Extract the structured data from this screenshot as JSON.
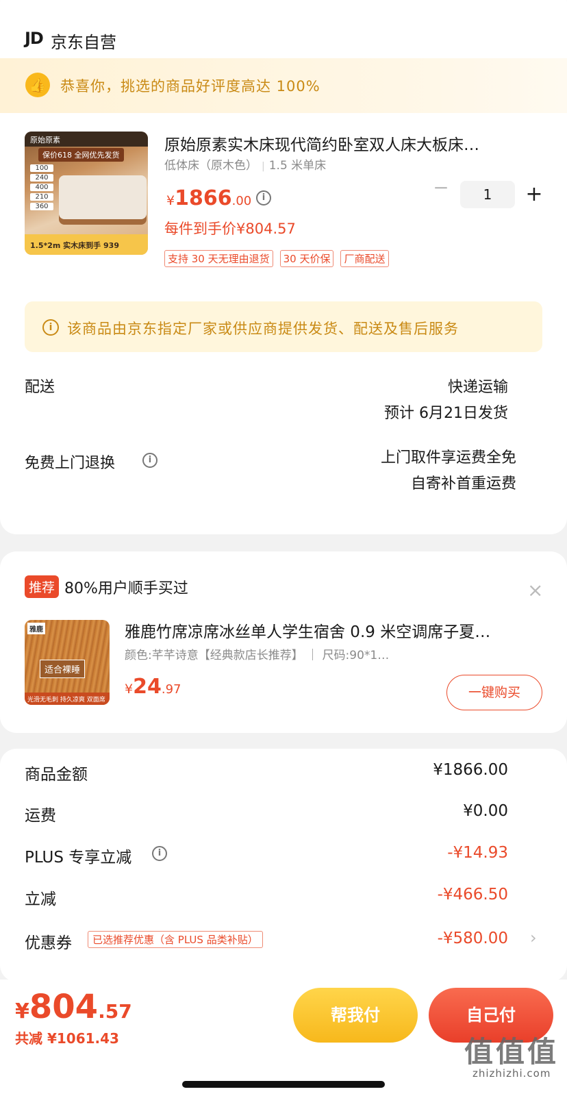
{
  "header": {
    "logo": "JD",
    "title": "京东自营"
  },
  "banner": {
    "text": "恭喜你，挑选的商品好评度高达 100%",
    "icon": "thumbs-up-icon"
  },
  "product": {
    "title": "原始原素实木床现代简约卧室双人床大板床…",
    "spec_color": "低体床（原木色）",
    "spec_size": "1.5 米单床",
    "price_currency": "¥",
    "price_int": "1866",
    "price_dec": ".00",
    "final_price": "每件到手价¥804.57",
    "tags": [
      "支持 30 天无理由退货",
      "30 天价保",
      "厂商配送"
    ],
    "quantity": "1",
    "minus": "−",
    "plus": "+",
    "image": {
      "brand": "原始原素",
      "promo": "保价618 全网优先发货",
      "sizes": [
        "100",
        "240",
        "400",
        "210",
        "360"
      ],
      "bottom": "1.5*2m 实木床到手 939"
    }
  },
  "notice": {
    "text": "该商品由京东指定厂家或供应商提供发货、配送及售后服务"
  },
  "delivery": {
    "label": "配送",
    "method": "快递运输",
    "eta": "预计 6月21日发货"
  },
  "returns": {
    "label": "免费上门退换",
    "line1": "上门取件享运费全免",
    "line2": "自寄补首重运费"
  },
  "recommend": {
    "tag": "推荐",
    "title": "80%用户顺手买过",
    "close": "×",
    "item_name": "雅鹿竹席凉席冰丝单人学生宿舍 0.9 米空调席子夏…",
    "item_spec": "颜色:芊芊诗意【经典款店长推荐】  ｜ 尺码:90*1…",
    "price_currency": "¥",
    "price_int": "24",
    "price_dec": ".97",
    "button": "一键购买",
    "image": {
      "logo": "雅鹿",
      "label": "适合裸睡",
      "foot": "光滑无毛刺 持久凉爽  双面席"
    }
  },
  "summary": {
    "rows": [
      {
        "label": "商品金额",
        "value": "¥1866.00"
      },
      {
        "label": "运费",
        "value": "¥0.00"
      },
      {
        "label": "PLUS 专享立减",
        "value": "-¥14.93"
      },
      {
        "label": "立减",
        "value": "-¥466.50"
      },
      {
        "label": "优惠券",
        "value": "-¥580.00"
      }
    ],
    "coupon_tag": "已选推荐优惠（含 PLUS 品类补贴）",
    "chevron": "›"
  },
  "bottom": {
    "currency": "¥",
    "total_int": "804",
    "total_dec": ".57",
    "saved": "共减 ¥1061.43",
    "help_pay": "帮我付",
    "self_pay": "自己付",
    "watermark": "值值值",
    "watermark_sub": "zhizhizhi.com"
  },
  "colors": {
    "accent": "#ea4a2a",
    "gold": "#c98a15",
    "yellow": "#f7b81c"
  }
}
